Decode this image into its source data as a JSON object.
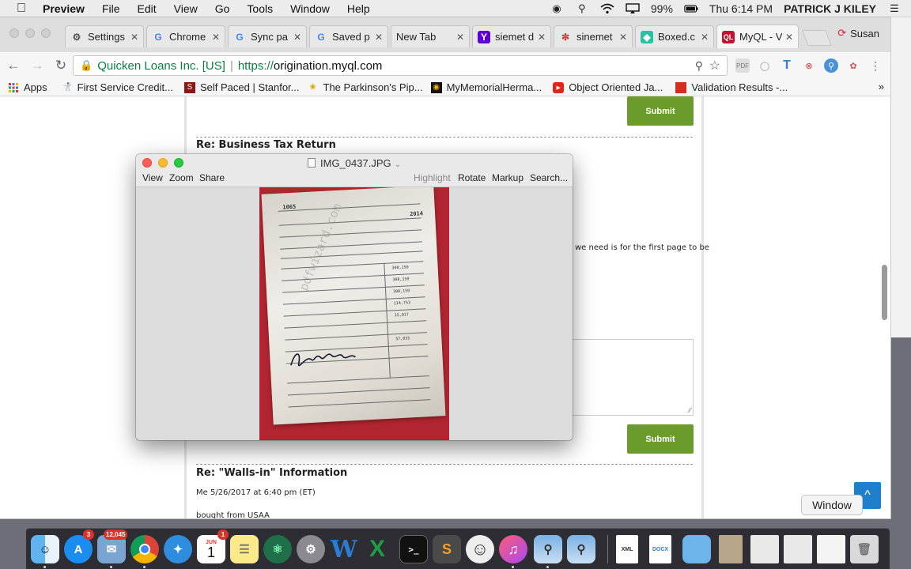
{
  "menubar": {
    "app": "Preview",
    "items": [
      "File",
      "Edit",
      "View",
      "Go",
      "Tools",
      "Window",
      "Help"
    ],
    "battery": "99%",
    "clock": "Thu 6:14 PM",
    "user": "PATRICK J KILEY"
  },
  "browser": {
    "tabs": [
      {
        "label": "Settings"
      },
      {
        "label": "Chrome"
      },
      {
        "label": "Sync pa"
      },
      {
        "label": "Saved p"
      },
      {
        "label": "New Tab"
      },
      {
        "label": "siemet d"
      },
      {
        "label": "sinemet"
      },
      {
        "label": "Boxed.c"
      },
      {
        "label": "MyQL - V"
      }
    ],
    "profile": "Susan",
    "address": {
      "ev_name": "Quicken Loans Inc. [US]",
      "scheme": "https://",
      "host": "origination.myql.com"
    },
    "bookmarks": [
      {
        "label": "Apps"
      },
      {
        "label": "First Service Credit..."
      },
      {
        "label": "Self Paced | Stanfor..."
      },
      {
        "label": "The Parkinson's Pip..."
      },
      {
        "label": "MyMemorialHerma..."
      },
      {
        "label": "Object Oriented Ja..."
      },
      {
        "label": "Validation Results -..."
      }
    ],
    "bookmarks_more": "»"
  },
  "page": {
    "submit_label": "Submit",
    "thread1": {
      "title": "Re: Business Tax Return",
      "fragment": "we need is for the first page to be"
    },
    "thread2": {
      "title": "Re: \"Walls-in\" Information",
      "meta": "Me   5/26/2017 at 6:40 pm (ET)",
      "body": "bought from USAA"
    },
    "scroll_top_glyph": "^"
  },
  "preview": {
    "filename": "IMG_0437.JPG",
    "toolbar_left": [
      "View",
      "Zoom",
      "Share"
    ],
    "toolbar_right": [
      "Highlight",
      "Rotate",
      "Markup",
      "Search..."
    ],
    "document": {
      "form_number": "1065",
      "year": "2014",
      "watermark": "pdfwizard.com",
      "signature_text": "Brian Kiley",
      "amounts": [
        "308,150",
        "308,150",
        "308,150",
        "114,753",
        "15,017",
        "57,035"
      ]
    }
  },
  "dock": {
    "items": [
      {
        "icon": "finder-icon"
      },
      {
        "icon": "app-store-icon",
        "badge": "3"
      },
      {
        "icon": "mail-icon",
        "badge": "12,045"
      },
      {
        "icon": "chrome-icon"
      },
      {
        "icon": "safari-icon"
      },
      {
        "icon": "calendar-icon",
        "badge": "1",
        "month": "JUN",
        "day": "1"
      },
      {
        "icon": "notes-icon"
      },
      {
        "icon": "atom-icon"
      },
      {
        "icon": "system-preferences-icon"
      },
      {
        "icon": "word-icon"
      },
      {
        "icon": "excel-icon"
      },
      {
        "icon": "terminal-icon"
      },
      {
        "icon": "sublime-text-icon"
      },
      {
        "icon": "smiley-app-icon"
      },
      {
        "icon": "itunes-icon"
      },
      {
        "icon": "preview-icon"
      },
      {
        "icon": "preview-alt-icon"
      },
      {
        "icon": "xml-file-icon",
        "label": "XML"
      },
      {
        "icon": "docx-file-icon",
        "label": "DOCX"
      },
      {
        "icon": "folder-icon"
      },
      {
        "icon": "document-thumb-icon"
      },
      {
        "icon": "window-thumb-1-icon"
      },
      {
        "icon": "window-thumb-2-icon"
      },
      {
        "icon": "window-thumb-3-icon"
      },
      {
        "icon": "trash-icon"
      }
    ],
    "tooltip": "Window"
  }
}
